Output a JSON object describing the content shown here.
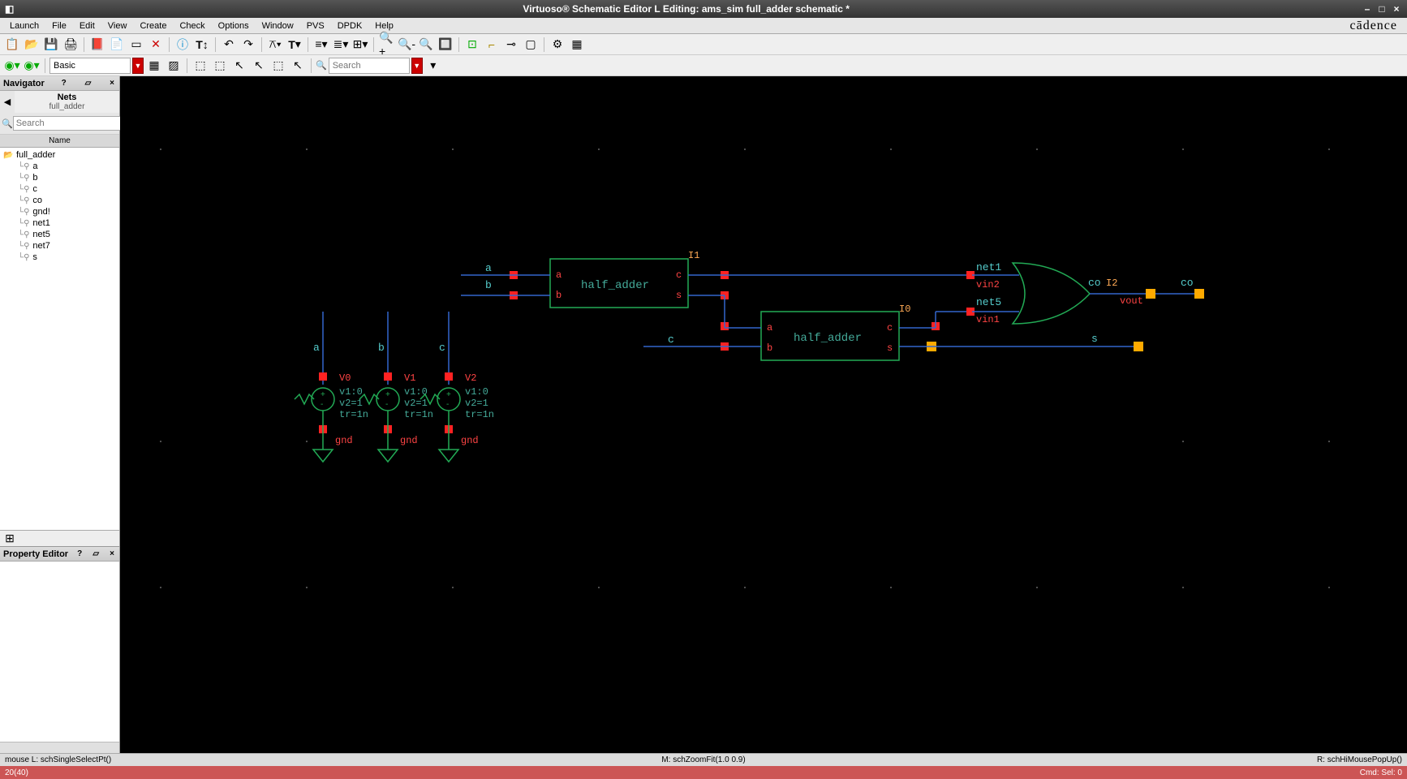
{
  "window": {
    "title": "Virtuoso® Schematic Editor L Editing: ams_sim full_adder schematic *"
  },
  "menubar": {
    "items": [
      "Launch",
      "File",
      "Edit",
      "View",
      "Create",
      "Check",
      "Options",
      "Window",
      "PVS",
      "DPDK",
      "Help"
    ],
    "brand": "cādence"
  },
  "toolbar2": {
    "select_value": "Basic",
    "search_placeholder": "Search"
  },
  "navigator": {
    "title": "Navigator",
    "scope_title": "Nets",
    "scope_sub": "full_adder",
    "search_placeholder": "Search",
    "list_header": "Name",
    "root": "full_adder",
    "nets": [
      "a",
      "b",
      "c",
      "co",
      "gnd!",
      "net1",
      "net5",
      "net7",
      "s"
    ]
  },
  "property_editor": {
    "title": "Property Editor"
  },
  "canvas": {
    "ha1": {
      "label": "half_adder",
      "inst": "I1",
      "pins": {
        "a": "a",
        "b": "b",
        "c": "c",
        "s": "s"
      }
    },
    "ha2": {
      "label": "half_adder",
      "inst": "I0",
      "pins": {
        "a": "a",
        "b": "b",
        "c": "c",
        "s": "s"
      }
    },
    "inputs": {
      "a": "a",
      "b": "b",
      "c": "c"
    },
    "or_gate": {
      "inst": "I2",
      "in1": "vin1",
      "in2": "vin2",
      "out": "vout",
      "co_left": "co",
      "co_right": "co"
    },
    "nets": {
      "net1": "net1",
      "net5": "net5",
      "s": "s"
    },
    "sources": [
      {
        "name": "V0",
        "lbl": "a",
        "params": [
          "v1:0",
          "v2=1",
          "tr=1n"
        ],
        "gnd": "gnd"
      },
      {
        "name": "V1",
        "lbl": "b",
        "params": [
          "v1:0",
          "v2=1",
          "tr=1n"
        ],
        "gnd": "gnd"
      },
      {
        "name": "V2",
        "lbl": "c",
        "params": [
          "v1:0",
          "v2=1",
          "tr=1n"
        ],
        "gnd": "gnd"
      }
    ]
  },
  "statusbar": {
    "left": "mouse L: schSingleSelectPt()",
    "center": "M: schZoomFit(1.0 0.9)",
    "right": "R: schHiMousePopUp()"
  },
  "statusbar2": {
    "left": "20(40)",
    "right": "Cmd:   Sel: 0"
  }
}
